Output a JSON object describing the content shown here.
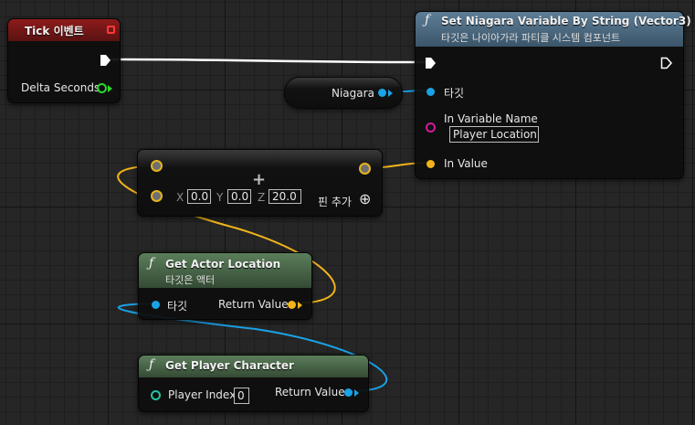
{
  "nodes": {
    "tick_event": {
      "title": "Tick 이벤트",
      "delta_label": "Delta Seconds"
    },
    "set_niagara": {
      "title": "Set Niagara Variable By String (Vector3)",
      "subtitle": "타깃은 나이아가라 파티클 시스템 컴포넌트",
      "target_label": "타깃",
      "in_variable_name_label": "In Variable Name",
      "in_variable_name_value": "Player Location",
      "in_value_label": "In Value"
    },
    "niagara_var": {
      "label": "Niagara"
    },
    "make_vector": {
      "x_label": "X",
      "x_value": "0.0",
      "y_label": "Y",
      "y_value": "0.0",
      "z_label": "Z",
      "z_value": "20.0",
      "add_pin_label": "핀 추가"
    },
    "get_actor_location": {
      "title": "Get Actor Location",
      "subtitle": "타깃은 액터",
      "target_label": "타깃",
      "return_label": "Return Value"
    },
    "get_player_character": {
      "title": "Get Player Character",
      "player_index_label": "Player Index",
      "player_index_value": "0",
      "return_label": "Return Value"
    }
  },
  "icons": {
    "function": "ƒ",
    "plus": "+",
    "add_pin": "⊕"
  },
  "colors": {
    "exec_wire": "#ffffff",
    "object_pin": "#1aa2e6",
    "vector_pin": "#f1b41b",
    "string_pin": "#d3199b",
    "float_pin": "#2bd62b",
    "int_pin": "#26c3a0",
    "event_header": "#8e1b1b",
    "function_header": "#4a6a84",
    "pure_header": "#4d6e4d"
  }
}
